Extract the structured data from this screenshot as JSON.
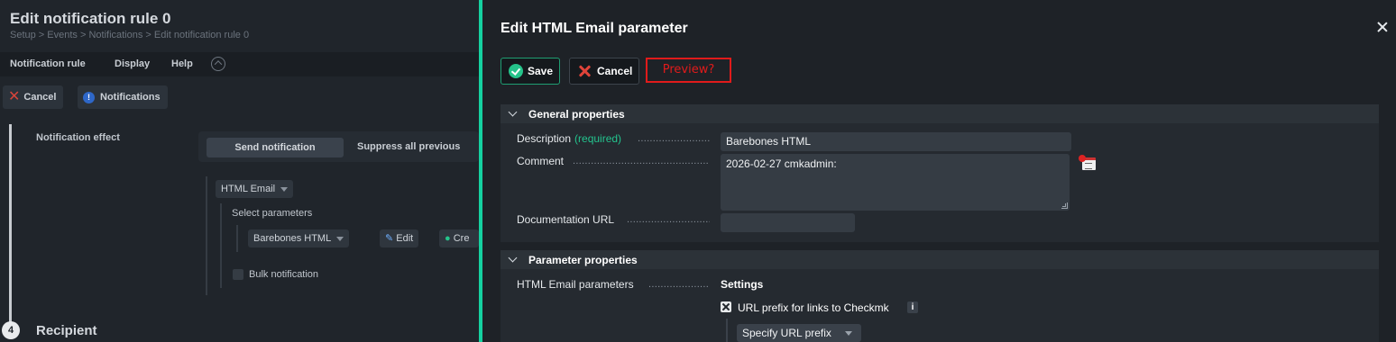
{
  "background_page": {
    "title": "Edit notification rule 0",
    "breadcrumb": "Setup > Events > Notifications > Edit notification rule 0",
    "menu": [
      "Notification rule",
      "Display",
      "Help"
    ],
    "cancel_label": "Cancel",
    "notifications_label": "Notifications",
    "notification_effect_label": "Notification effect",
    "send_notification": "Send notification",
    "suppress_all_previous": "Suppress all previous",
    "method": "HTML Email",
    "select_parameters": "Select parameters",
    "parameter_value": "Barebones HTML",
    "edit_label": "Edit",
    "create_label": "Cre",
    "bulk_notification": "Bulk notification",
    "step_number": "4",
    "recipient": "Recipient"
  },
  "panel": {
    "title": "Edit HTML Email parameter",
    "save_label": "Save",
    "cancel_label": "Cancel",
    "preview_label": "Preview?",
    "general_section": {
      "title": "General properties",
      "description_label": "Description",
      "required_label": "(required)",
      "description_value": "Barebones HTML",
      "comment_label": "Comment",
      "comment_value": "2026-02-27 cmkadmin:",
      "documentation_label": "Documentation URL",
      "documentation_value": ""
    },
    "parameter_section": {
      "title": "Parameter properties",
      "html_params_label": "HTML Email parameters",
      "settings_label": "Settings",
      "url_prefix_label": "URL prefix for links to Checkmk",
      "url_prefix_checked": true,
      "info_icon_text": "i",
      "url_prefix_option": "Specify URL prefix"
    }
  },
  "colors": {
    "accent": "#15d1a0",
    "save_icon": "#25c38a",
    "cancel_icon": "#e0443a",
    "preview_border": "#e01b1b",
    "required_text": "#23c48e"
  },
  "icons": [
    "close-icon",
    "check-circle-icon",
    "x-icon",
    "chevron-down-icon",
    "calendar-clock-icon",
    "info-icon",
    "resize-handle-icon"
  ]
}
